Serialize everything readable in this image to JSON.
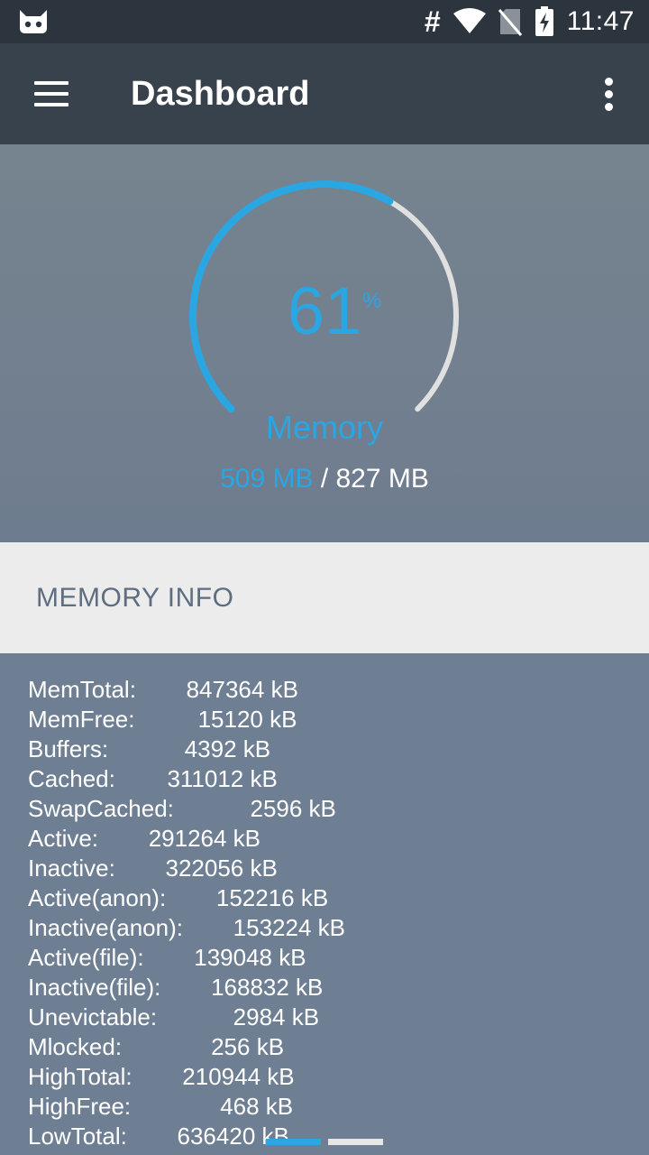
{
  "status_bar": {
    "time": "11:47",
    "hash_symbol": "#",
    "icons": [
      "cyanogenmod-icon",
      "hash-icon",
      "wifi-icon",
      "no-sim-icon",
      "battery-charging-icon"
    ]
  },
  "app_bar": {
    "title": "Dashboard",
    "menu_icon": "hamburger-menu-icon",
    "overflow_icon": "more-vert-icon"
  },
  "gauge": {
    "percent": "61",
    "percent_value": 0.61,
    "unit": "%",
    "label": "Memory",
    "used": "509 MB",
    "separator": " / ",
    "total": "827 MB",
    "accent_color": "#2aa6e2",
    "track_color": "#e0e0e0"
  },
  "memory_info": {
    "title": "MEMORY INFO",
    "rows": [
      {
        "key": "MemTotal:",
        "value": "847364 kB"
      },
      {
        "key": "MemFree:",
        "value": "15120 kB"
      },
      {
        "key": "Buffers:",
        "value": "4392 kB"
      },
      {
        "key": "Cached:",
        "value": "311012 kB"
      },
      {
        "key": "SwapCached:",
        "value": "2596 kB"
      },
      {
        "key": "Active:",
        "value": "291264 kB"
      },
      {
        "key": "Inactive:",
        "value": "322056 kB"
      },
      {
        "key": "Active(anon):",
        "value": "152216 kB"
      },
      {
        "key": "Inactive(anon):",
        "value": "153224 kB"
      },
      {
        "key": "Active(file):",
        "value": "139048 kB"
      },
      {
        "key": "Inactive(file):",
        "value": "168832 kB"
      },
      {
        "key": "Unevictable:",
        "value": "2984 kB"
      },
      {
        "key": "Mlocked:",
        "value": "256 kB"
      },
      {
        "key": "HighTotal:",
        "value": "210944 kB"
      },
      {
        "key": "HighFree:",
        "value": "468 kB"
      },
      {
        "key": "LowTotal:",
        "value": "636420 kB"
      }
    ]
  },
  "page_indicator": {
    "pages": 2,
    "active_index": 0
  }
}
